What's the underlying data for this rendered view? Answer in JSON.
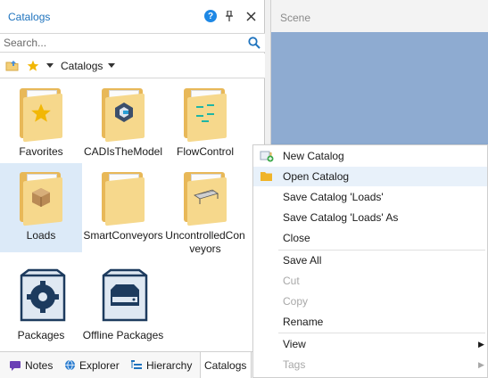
{
  "panel": {
    "title": "Catalogs",
    "help_icon": "?",
    "search_placeholder": "Search...",
    "toolbar_catalogs": "Catalogs"
  },
  "tiles": [
    {
      "label": "Favorites",
      "icon": "star-folder-icon"
    },
    {
      "label": "CADIsTheModel",
      "icon": "cad-folder-icon"
    },
    {
      "label": "FlowControl",
      "icon": "flow-folder-icon"
    },
    {
      "label": "Loads",
      "icon": "box-folder-icon"
    },
    {
      "label": "SmartConveyors",
      "icon": "folder-icon"
    },
    {
      "label": "UncontrolledCon",
      "label2": "veyors",
      "icon": "conveyor-folder-icon"
    },
    {
      "label": "Packages",
      "icon": "packages-icon"
    },
    {
      "label": "Offline Packages",
      "icon": "offline-packages-icon"
    }
  ],
  "bottom_tabs": [
    {
      "label": "Notes"
    },
    {
      "label": "Explorer"
    },
    {
      "label": "Hierarchy"
    },
    {
      "label": "Catalogs"
    }
  ],
  "scene": {
    "title": "Scene",
    "view_color": "#8eabd1"
  },
  "menu": {
    "items": [
      {
        "label": "New Catalog"
      },
      {
        "label": "Open Catalog"
      },
      {
        "label": "Save Catalog 'Loads'"
      },
      {
        "label": "Save Catalog 'Loads' As"
      },
      {
        "label": "Close"
      },
      {
        "label": "Save All"
      },
      {
        "label": "Cut"
      },
      {
        "label": "Copy"
      },
      {
        "label": "Rename"
      },
      {
        "label": "View"
      },
      {
        "label": "Tags"
      }
    ]
  },
  "colors": {
    "accent": "#1e73be",
    "selection": "#dceaf8",
    "folder": "#f6d88c"
  }
}
